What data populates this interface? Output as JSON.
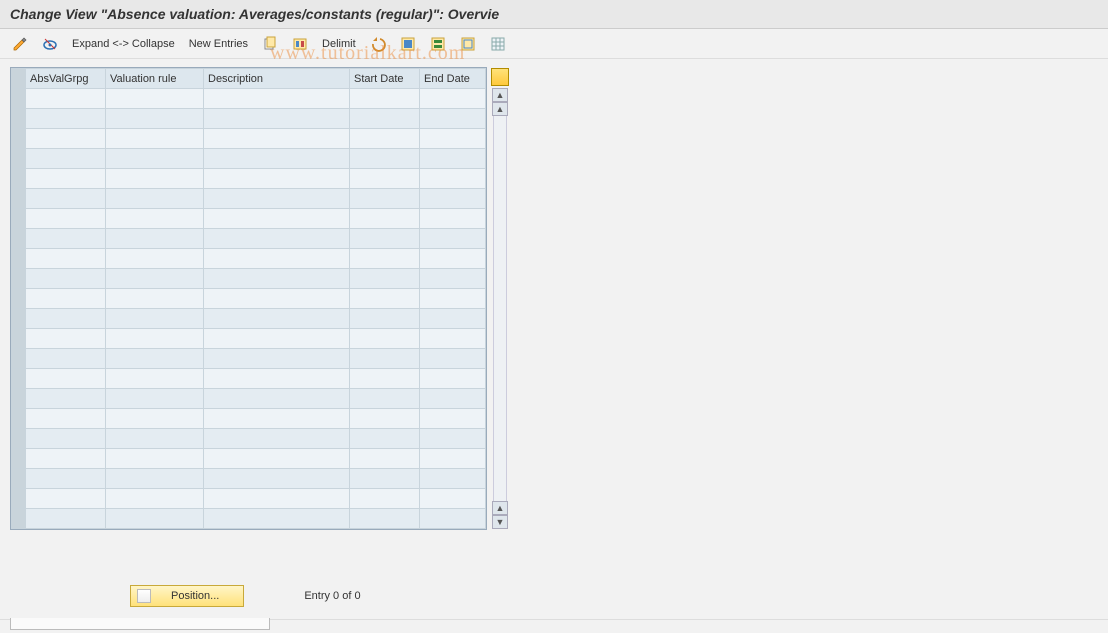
{
  "header": {
    "title": "Change View \"Absence valuation: Averages/constants (regular)\": Overvie"
  },
  "toolbar": {
    "expand_collapse": "Expand <-> Collapse",
    "new_entries": "New Entries",
    "delimit": "Delimit"
  },
  "table": {
    "columns": {
      "absvalgrpg": "AbsValGrpg",
      "valuation_rule": "Valuation rule",
      "description": "Description",
      "start_date": "Start Date",
      "end_date": "End Date"
    },
    "row_count": 22
  },
  "footer": {
    "position_label": "Position...",
    "entry_text": "Entry 0 of 0"
  },
  "watermark": "www.tutorialkart.com"
}
